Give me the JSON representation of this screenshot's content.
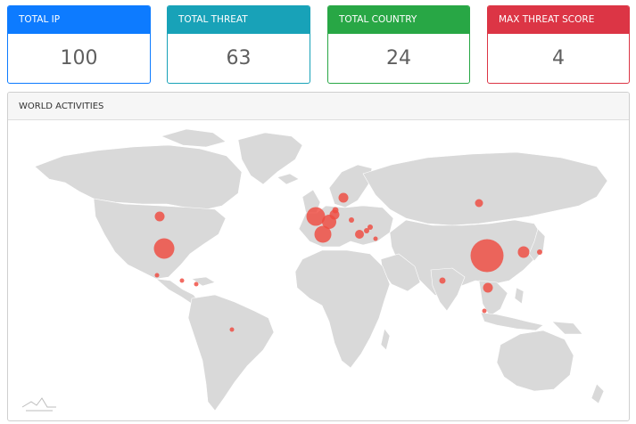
{
  "stats": [
    {
      "label": "TOTAL IP",
      "value": "100"
    },
    {
      "label": "TOTAL THREAT",
      "value": "63"
    },
    {
      "label": "TOTAL COUNTRY",
      "value": "24"
    },
    {
      "label": "MAX THREAT SCORE",
      "value": "4"
    }
  ],
  "world_panel": {
    "title": "WORLD ACTIVITIES"
  },
  "colors": {
    "marker": "#ef4a3f",
    "land": "#d9d9d9"
  }
}
